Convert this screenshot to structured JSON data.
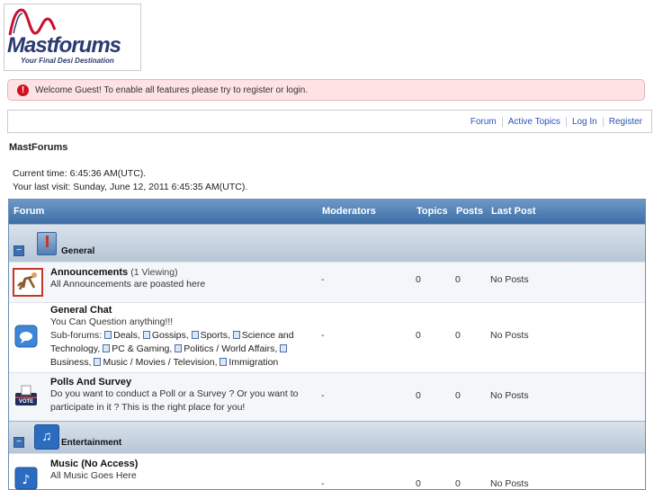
{
  "logo": {
    "name": "Mastforums",
    "tagline": "Your Final Desi Destination"
  },
  "notice": {
    "text": "Welcome Guest! To enable all features please try to register or login."
  },
  "nav": {
    "items": [
      "Forum",
      "Active Topics",
      "Log In",
      "Register"
    ]
  },
  "board": {
    "title": "MastForums",
    "current_time": "Current time: 6:45:36 AM(UTC).",
    "last_visit": "Your last visit: Sunday, June 12, 2011 6:45:35 AM(UTC)."
  },
  "table": {
    "headers": {
      "forum": "Forum",
      "moderators": "Moderators",
      "topics": "Topics",
      "posts": "Posts",
      "last_post": "Last Post"
    }
  },
  "categories": [
    {
      "name": "General",
      "toggle": "−",
      "forums": [
        {
          "name": "Announcements",
          "viewing": "(1 Viewing)",
          "desc": "All Announcements are poasted here",
          "moderators": "-",
          "topics": "0",
          "posts": "0",
          "last_post": "No Posts",
          "icon": "announcement-icon"
        },
        {
          "name": "General Chat",
          "desc": "You Can Question anything!!!",
          "subforums_label": "Sub-forums:",
          "subforums": [
            "Deals",
            "Gossips",
            "Sports",
            "Science and Technology",
            "PC & Gaming",
            "Politics / World Affairs",
            "Business",
            "Music / Movies / Television",
            "Immigration"
          ],
          "moderators": "-",
          "topics": "0",
          "posts": "0",
          "last_post": "No Posts",
          "icon": "chat-icon"
        },
        {
          "name": "Polls And Survey",
          "desc": "Do you want to conduct a Poll or a Survey ? Or you want to participate in it ? This is the right place for you!",
          "moderators": "-",
          "topics": "0",
          "posts": "0",
          "last_post": "No Posts",
          "icon": "vote-icon"
        }
      ]
    },
    {
      "name": "Entertainment",
      "toggle": "−",
      "forums": [
        {
          "name": "Music (No Access)",
          "desc": "All Music Goes Here",
          "moderators": "-",
          "topics": "0",
          "posts": "0",
          "last_post": "No Posts",
          "icon": "music-icon"
        }
      ]
    }
  ],
  "colors": {
    "header": "#3d6ea5",
    "notice_bg": "#fde3e4",
    "link": "#2a52be",
    "category_bg": "#c7d4e2"
  }
}
